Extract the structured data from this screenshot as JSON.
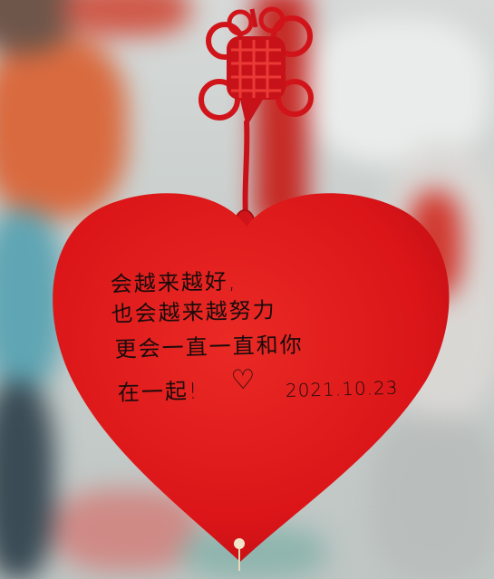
{
  "card": {
    "line1": "会越来越好,",
    "line2": "也会越来越努力",
    "line3": "更会一直一直和你",
    "line4": "在一起!",
    "heart_symbol": "♡",
    "date": "2021.10.23"
  },
  "colors": {
    "heart_red": "#e0171b",
    "knot_red": "#d1141a",
    "ink": "#1a0b0b"
  }
}
